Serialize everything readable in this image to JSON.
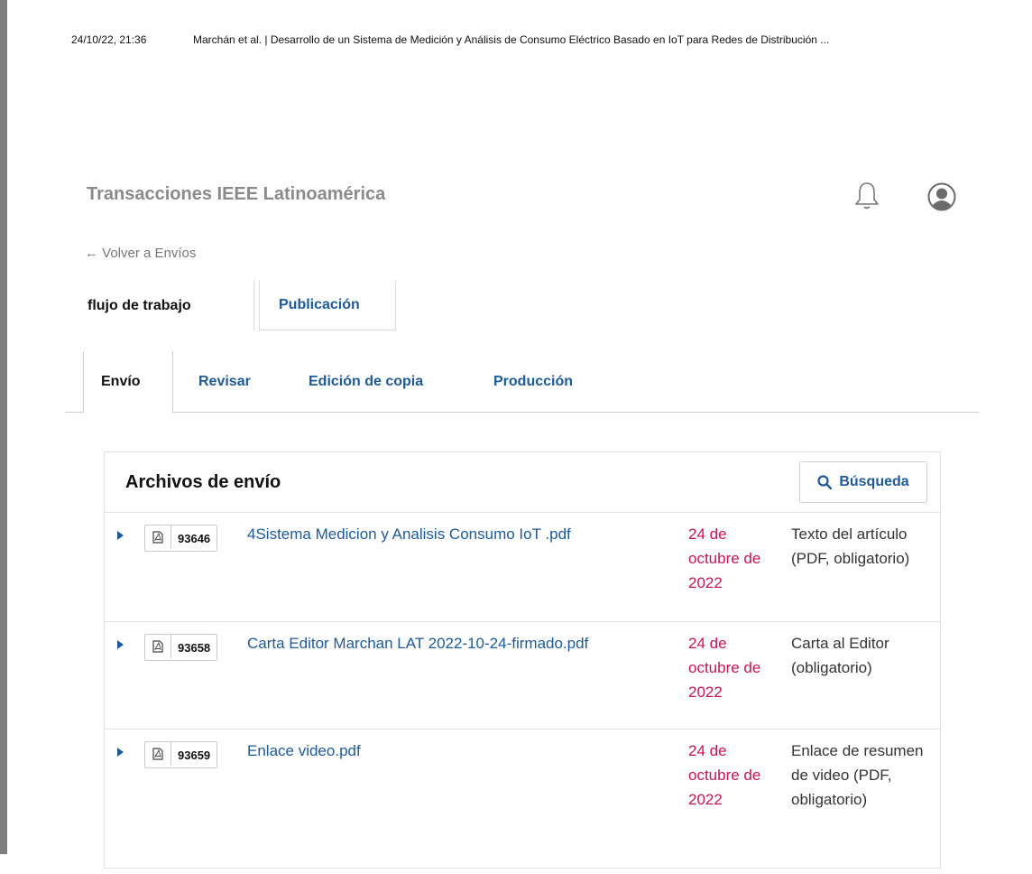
{
  "print_header": {
    "date": "24/10/22, 21:36",
    "title": "Marchán et al. | Desarrollo de un Sistema de Medición y Análisis de Consumo Eléctrico Basado en IoT para Redes de Distribución ..."
  },
  "header": {
    "journal_title": "Transacciones IEEE Latinoamérica",
    "icons": [
      "bell-icon",
      "user-icon"
    ]
  },
  "back_link": "← Volver a Envíos",
  "top_tabs": [
    {
      "label": "flujo de trabajo"
    },
    {
      "label": "Publicación"
    }
  ],
  "stage_tabs": [
    {
      "label": "Envío"
    },
    {
      "label": "Revisar"
    },
    {
      "label": "Edición de copia"
    },
    {
      "label": "Producción"
    }
  ],
  "files_panel": {
    "title": "Archivos de envío",
    "search_label": "Búsqueda",
    "files": [
      {
        "id": "93646",
        "name": "4Sistema Medicion y Analisis Consumo IoT .pdf",
        "date": "24 de octubre de 2022",
        "type": "Texto del artículo (PDF, obligatorio)"
      },
      {
        "id": "93658",
        "name": "Carta Editor Marchan LAT 2022-10-24-firmado.pdf",
        "date": "24 de octubre de 2022",
        "type": "Carta al Editor (obligatorio)"
      },
      {
        "id": "93659",
        "name": "Enlace video.pdf",
        "date": "24 de octubre de 2022",
        "type": "Enlace de resumen de video (PDF, obligatorio)"
      }
    ]
  },
  "colors": {
    "link": "#1e5a96",
    "date": "#c4145a",
    "muted": "#8a8a8a"
  }
}
